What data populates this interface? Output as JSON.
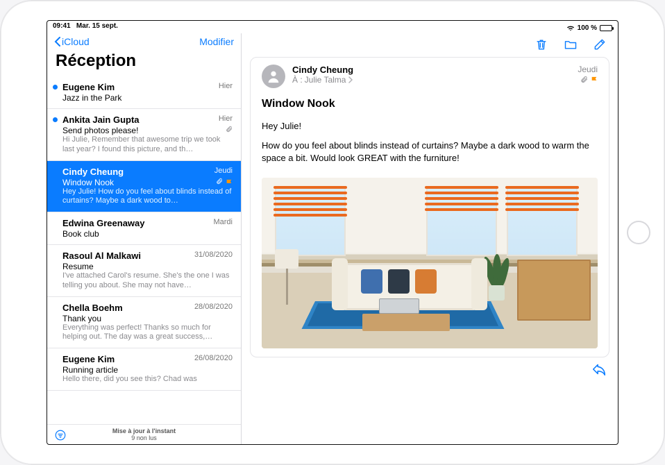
{
  "status": {
    "time": "09:41",
    "date": "Mar. 15 sept.",
    "battery": "100 %"
  },
  "colors": {
    "accent": "#0a7cff",
    "flag": "#ff9500"
  },
  "sidebar": {
    "back_label": "iCloud",
    "edit_label": "Modifier",
    "title": "Réception",
    "footer_line1": "Mise à jour à l'instant",
    "footer_line2": "9 non lus"
  },
  "messages": [
    {
      "sender": "Eugene Kim",
      "date": "Hier",
      "subject": "Jazz in the Park",
      "preview": "",
      "unread": true,
      "selected": false,
      "attachment": false,
      "flagged": false
    },
    {
      "sender": "Ankita Jain Gupta",
      "date": "Hier",
      "subject": "Send photos please!",
      "preview": "Hi Julie, Remember that awesome trip we took last year? I found this picture, and th…",
      "unread": true,
      "selected": false,
      "attachment": true,
      "flagged": false
    },
    {
      "sender": "Cindy Cheung",
      "date": "Jeudi",
      "subject": "Window Nook",
      "preview": "Hey Julie! How do you feel about blinds instead of curtains? Maybe a dark wood to…",
      "unread": false,
      "selected": true,
      "attachment": true,
      "flagged": true
    },
    {
      "sender": "Edwina Greenaway",
      "date": "Mardi",
      "subject": "Book club",
      "preview": "",
      "unread": false,
      "selected": false,
      "attachment": false,
      "flagged": false
    },
    {
      "sender": "Rasoul Al Malkawi",
      "date": "31/08/2020",
      "subject": "Resume",
      "preview": "I've attached Carol's resume. She's the one I was telling you about. She may not have…",
      "unread": false,
      "selected": false,
      "attachment": false,
      "flagged": false
    },
    {
      "sender": "Chella Boehm",
      "date": "28/08/2020",
      "subject": "Thank you",
      "preview": "Everything was perfect! Thanks so much for helping out. The day was a great success,…",
      "unread": false,
      "selected": false,
      "attachment": false,
      "flagged": false
    },
    {
      "sender": "Eugene Kim",
      "date": "26/08/2020",
      "subject": "Running article",
      "preview": "Hello there, did you see this? Chad was",
      "unread": false,
      "selected": false,
      "attachment": false,
      "flagged": false
    }
  ],
  "open_message": {
    "from": "Cindy Cheung",
    "to_label": "À :",
    "to_name": "Julie Talma",
    "date": "Jeudi",
    "attachment": true,
    "flagged": true,
    "subject": "Window Nook",
    "greeting": "Hey Julie!",
    "body": "How do you feel about blinds instead of curtains? Maybe a dark wood to warm the space a bit. Would look GREAT with the furniture!"
  }
}
